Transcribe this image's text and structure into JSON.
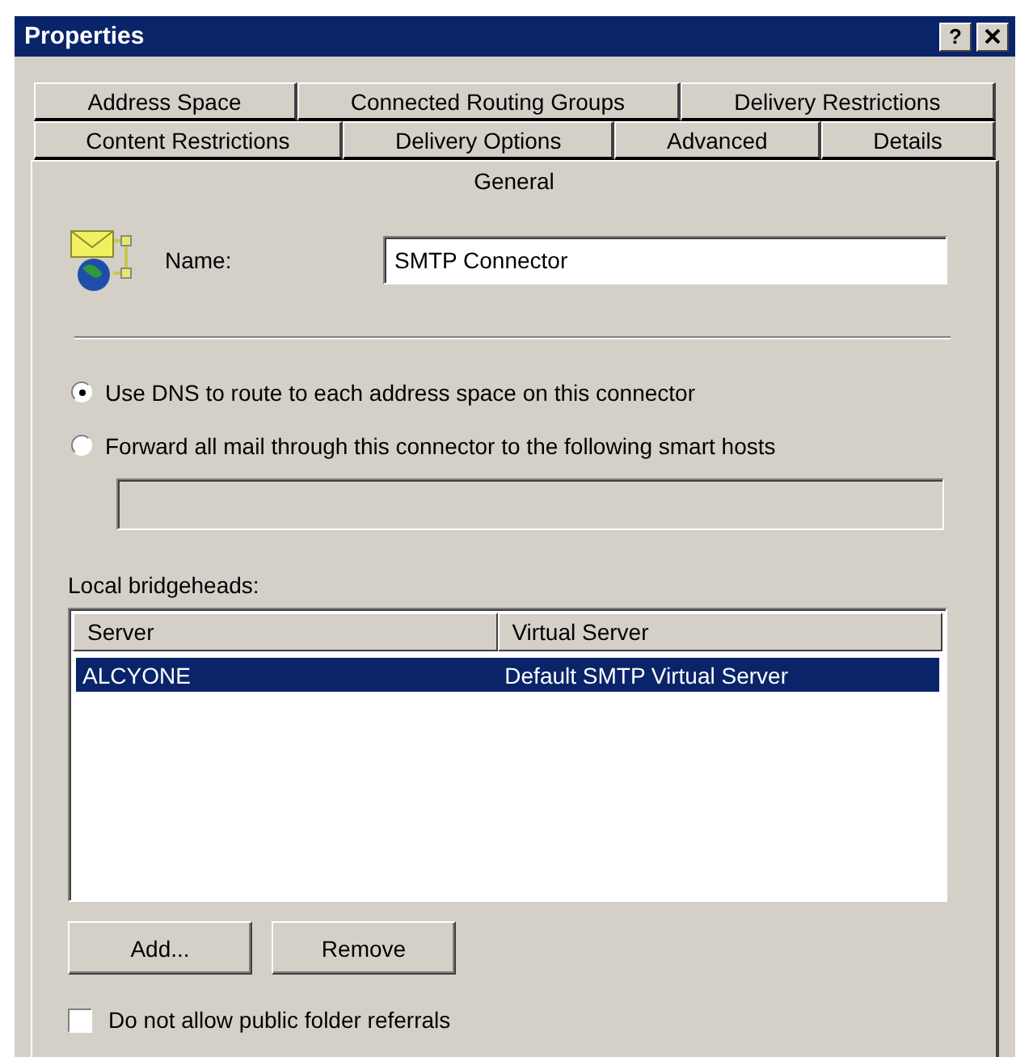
{
  "window": {
    "title": "Properties",
    "help_button": "?"
  },
  "tab_rows": [
    [
      {
        "label": "Address Space",
        "selected": false
      },
      {
        "label": "Connected Routing Groups",
        "selected": false
      },
      {
        "label": "Delivery Restrictions",
        "selected": false
      }
    ],
    [
      {
        "label": "Content Restrictions",
        "selected": false
      },
      {
        "label": "Delivery Options",
        "selected": false
      },
      {
        "label": "Advanced",
        "selected": false
      },
      {
        "label": "Details",
        "selected": false
      }
    ],
    [
      {
        "label": "General",
        "selected": true
      }
    ]
  ],
  "name_field": {
    "label": "Name:",
    "value": "SMTP Connector"
  },
  "routing_options": [
    {
      "label": "Use DNS to route to each address space on this connector",
      "selected": true
    },
    {
      "label": "Forward all mail through this connector to the following smart hosts",
      "selected": false
    }
  ],
  "smart_hosts_field": {
    "disabled": true
  },
  "bridgeheads": {
    "label": "Local bridgeheads:",
    "columns": [
      "Server",
      "Virtual Server"
    ],
    "rows": [
      {
        "cells": [
          "ALCYONE",
          "Default SMTP Virtual Server"
        ],
        "selected": true
      }
    ]
  },
  "buttons": [
    "Add...",
    "Remove"
  ],
  "public_folder_referrals": {
    "label": "Do not allow public folder referrals",
    "checked": false
  }
}
